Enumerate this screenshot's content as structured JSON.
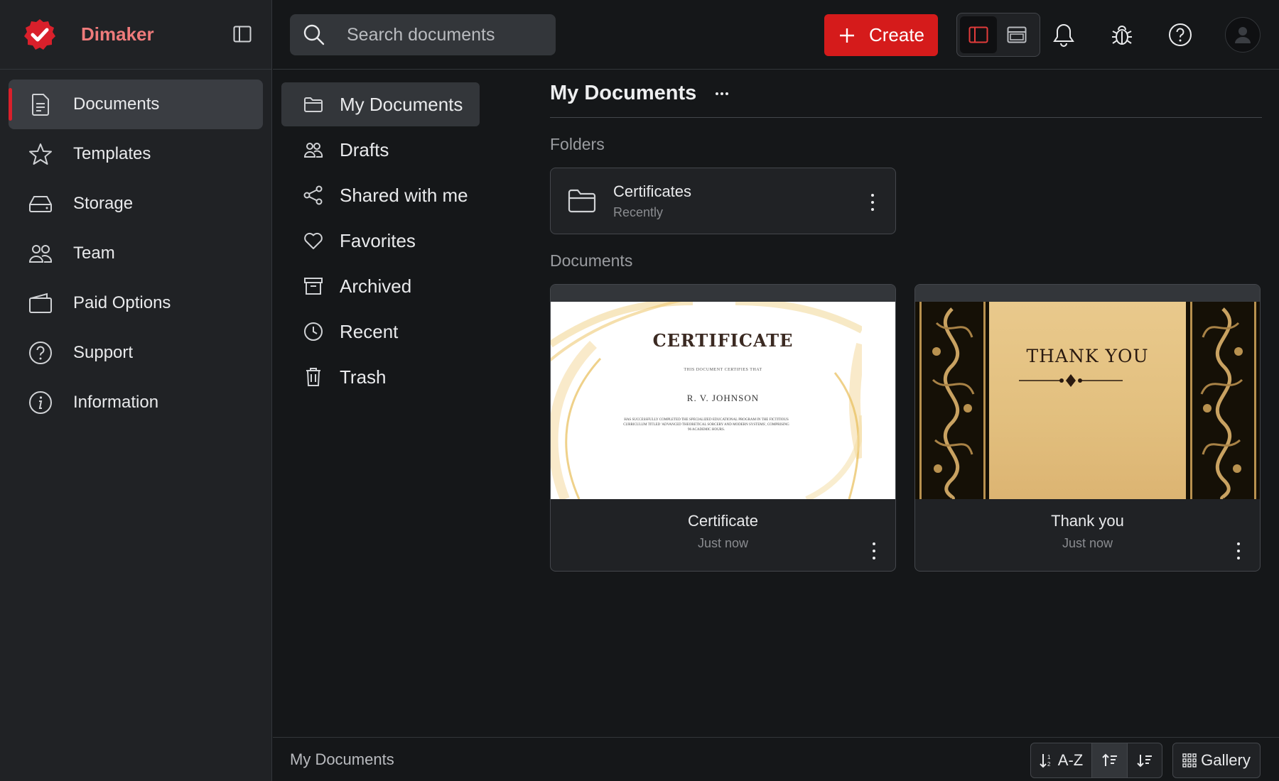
{
  "brand": {
    "name": "Dimaker"
  },
  "sidebar": {
    "items": [
      {
        "label": "Documents",
        "icon": "document-icon",
        "active": true
      },
      {
        "label": "Templates",
        "icon": "star-icon"
      },
      {
        "label": "Storage",
        "icon": "storage-drive-icon"
      },
      {
        "label": "Team",
        "icon": "team-icon"
      },
      {
        "label": "Paid Options",
        "icon": "wallet-icon"
      },
      {
        "label": "Support",
        "icon": "help-circle-icon"
      },
      {
        "label": "Information",
        "icon": "info-icon"
      }
    ]
  },
  "topbar": {
    "search_placeholder": "Search documents",
    "create_label": "Create"
  },
  "subnav": {
    "items": [
      {
        "label": "My Documents",
        "icon": "folder-icon",
        "active": true
      },
      {
        "label": "Drafts",
        "icon": "drafts-people-icon"
      },
      {
        "label": "Shared with me",
        "icon": "share-icon"
      },
      {
        "label": "Favorites",
        "icon": "heart-icon"
      },
      {
        "label": "Archived",
        "icon": "archive-icon"
      },
      {
        "label": "Recent",
        "icon": "clock-icon"
      },
      {
        "label": "Trash",
        "icon": "trash-icon"
      }
    ]
  },
  "main": {
    "title": "My Documents",
    "folders_label": "Folders",
    "documents_label": "Documents",
    "folders": [
      {
        "name": "Certificates",
        "sub": "Recently"
      }
    ],
    "documents": [
      {
        "name": "Certificate",
        "sub": "Just now",
        "thumb": {
          "heading": "CERTIFICATE",
          "line1": "THIS DOCUMENT CERTIFIES THAT",
          "person": "R. V. JOHNSON",
          "body": "HAS SUCCESSFULLY COMPLETED THE SPECIALIZED EDUCATIONAL PROGRAM IN THE FICTITIOUS CURRICULUM TITLED 'ADVANCED THEORETICAL SORCERY AND MODERN SYSTEMS', COMPRISING 96 ACADEMIC HOURS."
        }
      },
      {
        "name": "Thank you",
        "sub": "Just now",
        "thumb": {
          "heading": "THANK YOU"
        }
      }
    ]
  },
  "bottombar": {
    "breadcrumb": "My Documents",
    "sort_label": "A-Z",
    "gallery_label": "Gallery"
  },
  "colors": {
    "accent_red": "#d51b1b",
    "brand_text": "#ef7b7b",
    "background": "#151719",
    "panel": "#202225"
  }
}
